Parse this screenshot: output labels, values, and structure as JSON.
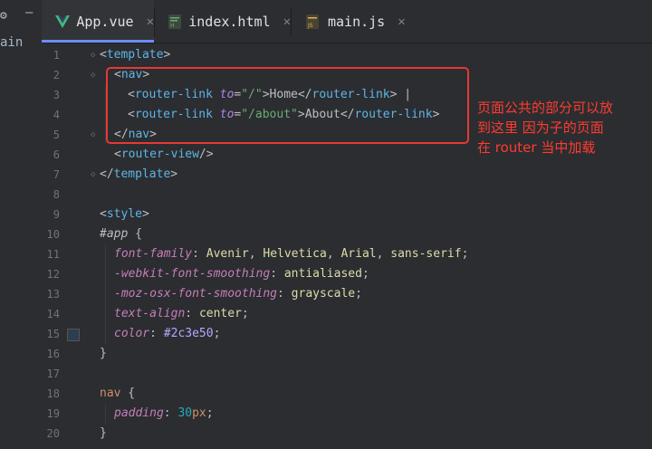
{
  "sidebar": {
    "project_label": "ain",
    "settings_icon": "gear-icon",
    "collapse_icon": "minus-icon"
  },
  "tabs": [
    {
      "label": "App.vue",
      "icon": "vue-icon",
      "active": true
    },
    {
      "label": "index.html",
      "icon": "html-icon",
      "active": false
    },
    {
      "label": "main.js",
      "icon": "js-icon",
      "active": false
    }
  ],
  "line_numbers": [
    "1",
    "2",
    "3",
    "4",
    "5",
    "6",
    "7",
    "8",
    "9",
    "10",
    "11",
    "12",
    "13",
    "14",
    "15",
    "16",
    "17",
    "18",
    "19",
    "20"
  ],
  "code": {
    "l1": {
      "open": "<",
      "tag": "template",
      "close": ">"
    },
    "l2": {
      "open": "<",
      "tag": "nav",
      "close": ">"
    },
    "l3": {
      "open": "<",
      "tag": "router-link",
      "attr": "to",
      "eq": "=",
      "str": "\"/\"",
      "gt": ">",
      "text": "Home",
      "endopen": "</",
      "endtag": "router-link",
      "endclose": ">",
      "after": " |"
    },
    "l4": {
      "open": "<",
      "tag": "router-link",
      "attr": "to",
      "eq": "=",
      "str": "\"/about\"",
      "gt": ">",
      "text": "About",
      "endopen": "</",
      "endtag": "router-link",
      "endclose": ">"
    },
    "l5": {
      "open": "</",
      "tag": "nav",
      "close": ">"
    },
    "l6": {
      "open": "<",
      "tag": "router-view",
      "close": "/>"
    },
    "l7": {
      "open": "</",
      "tag": "template",
      "close": ">"
    },
    "l9": {
      "open": "<",
      "tag": "style",
      "close": ">"
    },
    "l10": {
      "selector": "#app",
      "brace": " {"
    },
    "l11": {
      "prop": "font-family",
      "colon": ": ",
      "values": [
        "Avenir",
        "Helvetica",
        "Arial",
        "sans-serif"
      ],
      "sep": ", ",
      "semi": ";"
    },
    "l12": {
      "prop": "-webkit-font-smoothing",
      "colon": ": ",
      "value": "antialiased",
      "semi": ";"
    },
    "l13": {
      "prop": "-moz-osx-font-smoothing",
      "colon": ": ",
      "value": "grayscale",
      "semi": ";"
    },
    "l14": {
      "prop": "text-align",
      "colon": ": ",
      "value": "center",
      "semi": ";"
    },
    "l15": {
      "prop": "color",
      "colon": ": ",
      "value": "#2c3e50",
      "semi": ";"
    },
    "l16": {
      "brace": "}"
    },
    "l18": {
      "selector": "nav",
      "brace": " {"
    },
    "l19": {
      "prop": "padding",
      "colon": ": ",
      "num": "30",
      "unit": "px",
      "semi": ";"
    },
    "l20": {
      "brace": "}"
    }
  },
  "annotation": {
    "lines": [
      "页面公共的部分可以放",
      "到这里 因为子的页面",
      "在 router 当中加载"
    ]
  },
  "colors": {
    "highlight": "#e53935",
    "annotation": "#ff3b30",
    "swatch": "#2c3e50"
  }
}
